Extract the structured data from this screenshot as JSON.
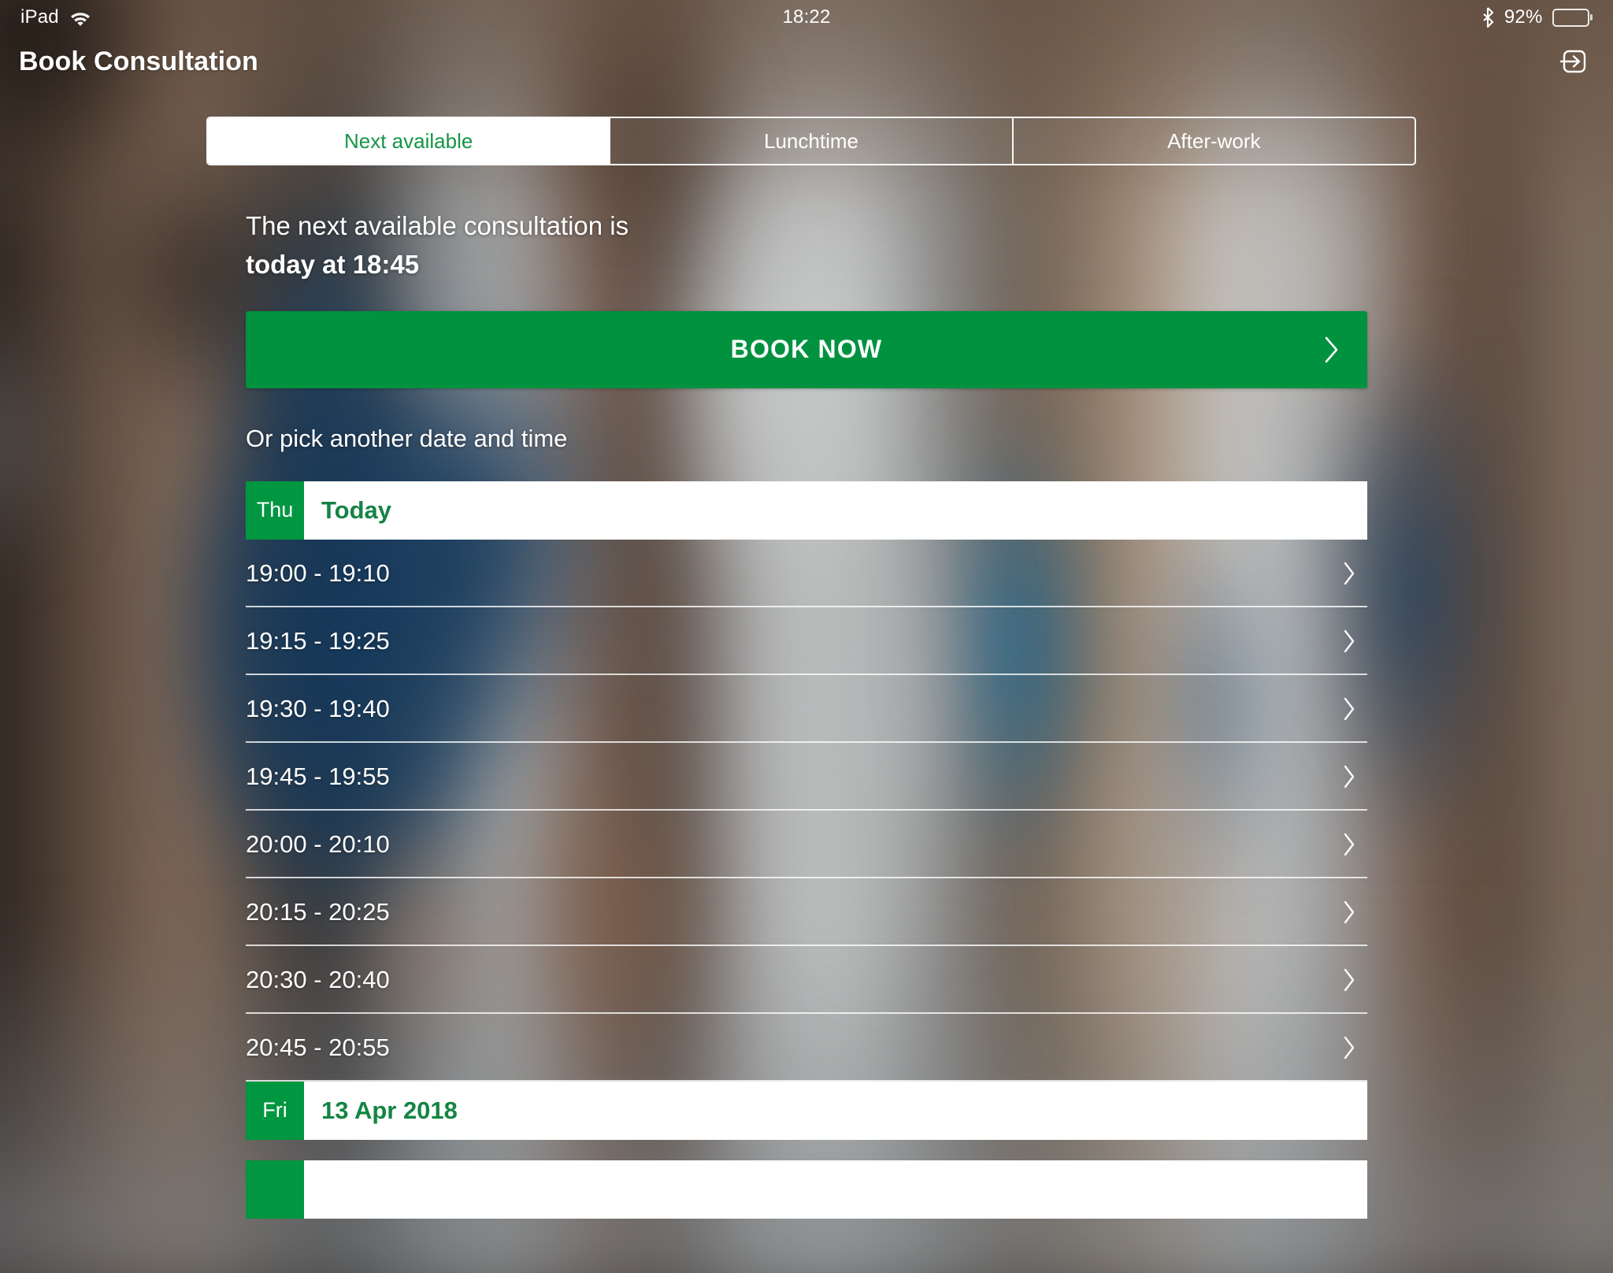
{
  "status_bar": {
    "device_label": "iPad",
    "wifi_icon": "wifi-icon",
    "time": "18:22",
    "bluetooth_icon": "bluetooth-icon",
    "battery_percent": "92%",
    "battery_level": 92
  },
  "nav": {
    "title": "Book Consultation",
    "logout_icon": "logout-icon"
  },
  "tabs": [
    {
      "label": "Next available",
      "active": true
    },
    {
      "label": "Lunchtime",
      "active": false
    },
    {
      "label": "After-work",
      "active": false
    }
  ],
  "lead": {
    "line1": "The next available consultation is",
    "line2": "today at 18:45"
  },
  "book_now": {
    "label": "BOOK NOW",
    "chevron_icon": "chevron-right-icon"
  },
  "pick_another": {
    "label": "Or pick another date and time"
  },
  "groups": [
    {
      "day_abbrev": "Thu",
      "date_label": "Today",
      "slots": [
        "19:00 - 19:10",
        "19:15 - 19:25",
        "19:30 - 19:40",
        "19:45 - 19:55",
        "20:00 - 20:10",
        "20:15 - 20:25",
        "20:30 - 20:40",
        "20:45 - 20:55"
      ]
    },
    {
      "day_abbrev": "Fri",
      "date_label": "13 Apr 2018",
      "slots": []
    },
    {
      "day_abbrev": "",
      "date_label": "",
      "slots": []
    }
  ],
  "colors": {
    "brand_green": "#00923F",
    "badge_green": "#019640",
    "text_green": "#148444",
    "tab_active_text": "#159447",
    "white": "#FFFFFF"
  }
}
